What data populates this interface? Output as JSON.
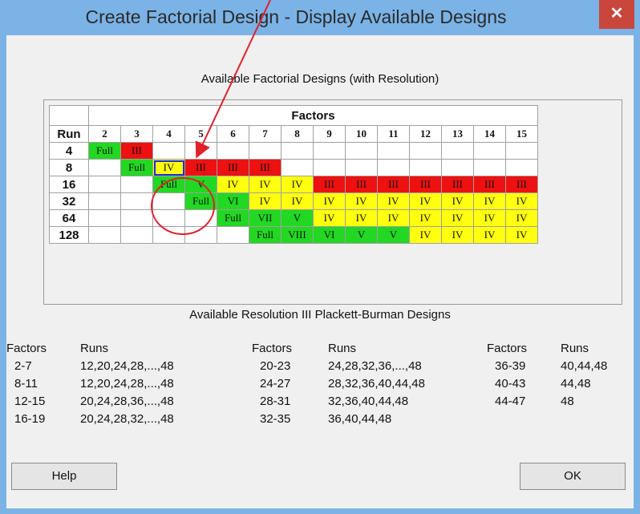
{
  "window": {
    "title": "Create Factorial Design - Display Available Designs",
    "close_glyph": "✕"
  },
  "grid_caption": "Available Factorial Designs (with Resolution)",
  "factors_header": "Factors",
  "run_header": "Run",
  "factor_columns": [
    "2",
    "3",
    "4",
    "5",
    "6",
    "7",
    "8",
    "9",
    "10",
    "11",
    "12",
    "13",
    "14",
    "15"
  ],
  "rows": [
    {
      "run": "4",
      "cells": [
        [
          "Full",
          "g"
        ],
        [
          "III",
          "r"
        ],
        [
          "",
          "w"
        ],
        [
          "",
          "w"
        ],
        [
          "",
          "w"
        ],
        [
          "",
          "w"
        ],
        [
          "",
          "w"
        ],
        [
          "",
          "w"
        ],
        [
          "",
          "w"
        ],
        [
          "",
          "w"
        ],
        [
          "",
          "w"
        ],
        [
          "",
          "w"
        ],
        [
          "",
          "w"
        ],
        [
          "",
          "w"
        ]
      ]
    },
    {
      "run": "8",
      "cells": [
        [
          "",
          "w"
        ],
        [
          "Full",
          "g"
        ],
        [
          "IV",
          "y"
        ],
        [
          "III",
          "r"
        ],
        [
          "III",
          "r"
        ],
        [
          "III",
          "r"
        ],
        [
          "",
          "w"
        ],
        [
          "",
          "w"
        ],
        [
          "",
          "w"
        ],
        [
          "",
          "w"
        ],
        [
          "",
          "w"
        ],
        [
          "",
          "w"
        ],
        [
          "",
          "w"
        ],
        [
          "",
          "w"
        ]
      ]
    },
    {
      "run": "16",
      "cells": [
        [
          "",
          "w"
        ],
        [
          "",
          "w"
        ],
        [
          "Full",
          "g"
        ],
        [
          "V",
          "g"
        ],
        [
          "IV",
          "y"
        ],
        [
          "IV",
          "y"
        ],
        [
          "IV",
          "y"
        ],
        [
          "III",
          "r"
        ],
        [
          "III",
          "r"
        ],
        [
          "III",
          "r"
        ],
        [
          "III",
          "r"
        ],
        [
          "III",
          "r"
        ],
        [
          "III",
          "r"
        ],
        [
          "III",
          "r"
        ]
      ]
    },
    {
      "run": "32",
      "cells": [
        [
          "",
          "w"
        ],
        [
          "",
          "w"
        ],
        [
          "",
          "w"
        ],
        [
          "Full",
          "g"
        ],
        [
          "VI",
          "g"
        ],
        [
          "IV",
          "y"
        ],
        [
          "IV",
          "y"
        ],
        [
          "IV",
          "y"
        ],
        [
          "IV",
          "y"
        ],
        [
          "IV",
          "y"
        ],
        [
          "IV",
          "y"
        ],
        [
          "IV",
          "y"
        ],
        [
          "IV",
          "y"
        ],
        [
          "IV",
          "y"
        ]
      ]
    },
    {
      "run": "64",
      "cells": [
        [
          "",
          "w"
        ],
        [
          "",
          "w"
        ],
        [
          "",
          "w"
        ],
        [
          "",
          "w"
        ],
        [
          "Full",
          "g"
        ],
        [
          "VII",
          "g"
        ],
        [
          "V",
          "g"
        ],
        [
          "IV",
          "y"
        ],
        [
          "IV",
          "y"
        ],
        [
          "IV",
          "y"
        ],
        [
          "IV",
          "y"
        ],
        [
          "IV",
          "y"
        ],
        [
          "IV",
          "y"
        ],
        [
          "IV",
          "y"
        ]
      ]
    },
    {
      "run": "128",
      "cells": [
        [
          "",
          "w"
        ],
        [
          "",
          "w"
        ],
        [
          "",
          "w"
        ],
        [
          "",
          "w"
        ],
        [
          "",
          "w"
        ],
        [
          "Full",
          "g"
        ],
        [
          "VIII",
          "g"
        ],
        [
          "VI",
          "g"
        ],
        [
          "V",
          "g"
        ],
        [
          "V",
          "g"
        ],
        [
          "IV",
          "y"
        ],
        [
          "IV",
          "y"
        ],
        [
          "IV",
          "y"
        ],
        [
          "IV",
          "y"
        ]
      ]
    }
  ],
  "pb_caption": "Available Resolution III Plackett-Burman Designs",
  "pb_columns": [
    {
      "factors_label": "Factors",
      "runs_label": "Runs",
      "items": [
        [
          "2-7",
          "12,20,24,28,...,48"
        ],
        [
          "8-11",
          "12,20,24,28,...,48"
        ],
        [
          "12-15",
          "20,24,28,36,...,48"
        ],
        [
          "16-19",
          "20,24,28,32,...,48"
        ]
      ]
    },
    {
      "factors_label": "Factors",
      "runs_label": "Runs",
      "items": [
        [
          "20-23",
          "24,28,32,36,...,48"
        ],
        [
          "24-27",
          "28,32,36,40,44,48"
        ],
        [
          "28-31",
          "32,36,40,44,48"
        ],
        [
          "32-35",
          "36,40,44,48"
        ]
      ]
    },
    {
      "factors_label": "Factors",
      "runs_label": "Runs",
      "items": [
        [
          "36-39",
          "40,44,48"
        ],
        [
          "40-43",
          "44,48"
        ],
        [
          "44-47",
          "48"
        ]
      ]
    }
  ],
  "buttons": {
    "help": "Help",
    "ok": "OK"
  },
  "colors": {
    "full": "#22d822",
    "res_high": "#22d822",
    "res_iv": "#ffff10",
    "res_iii": "#ee1111",
    "annotation": "#e0202a",
    "selection": "#1e2fd6"
  }
}
